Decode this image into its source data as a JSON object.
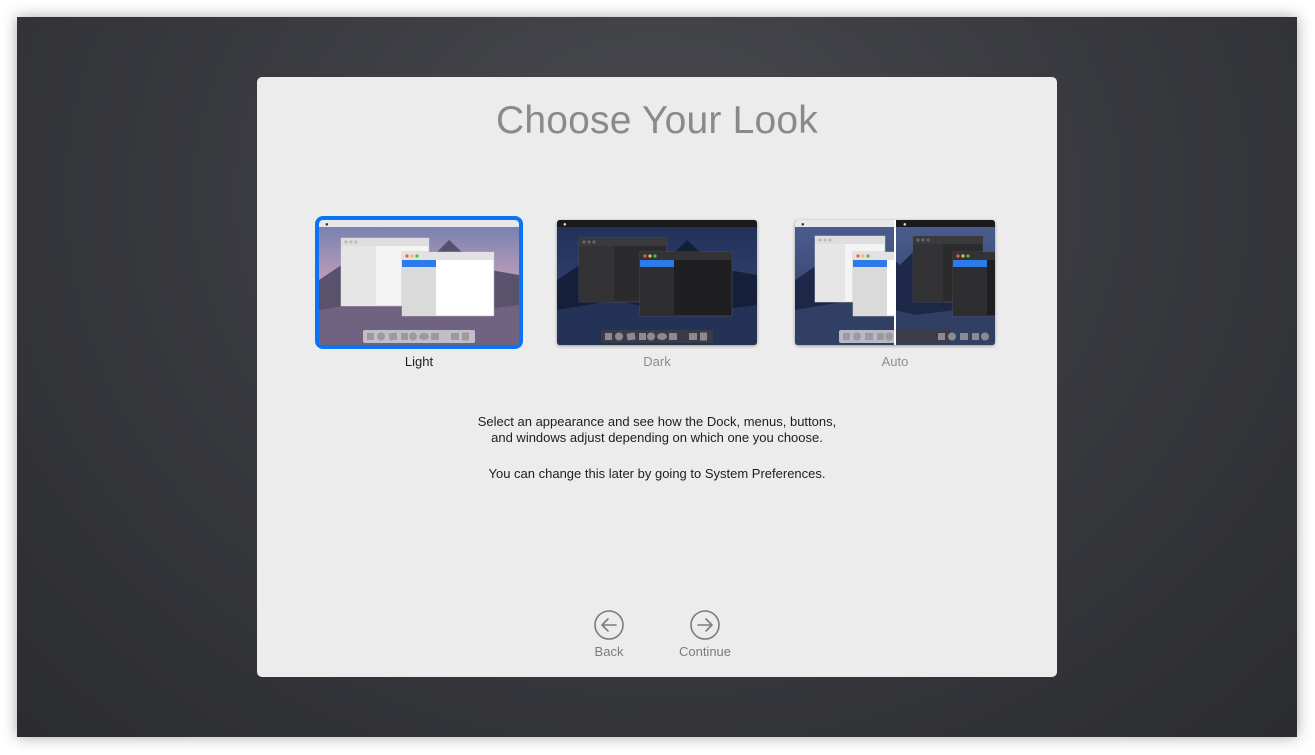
{
  "screen": {
    "title": "Choose Your Look",
    "options": [
      {
        "label": "Light",
        "selected": true
      },
      {
        "label": "Dark",
        "selected": false
      },
      {
        "label": "Auto",
        "selected": false
      }
    ],
    "description": {
      "line1": "Select an appearance and see how the Dock, menus, buttons,",
      "line2": "and windows adjust depending on which one you choose.",
      "line3": "You can change this later by going to System Preferences."
    },
    "buttons": {
      "back_label": "Back",
      "continue_label": "Continue"
    }
  },
  "colors": {
    "accent": "#0a74f5",
    "panel_bg": "#ececec",
    "screen_bg": "#3a3b40"
  },
  "icons": [
    "arrow-left-circle-icon",
    "arrow-right-circle-icon",
    "apple-logo-icon"
  ]
}
